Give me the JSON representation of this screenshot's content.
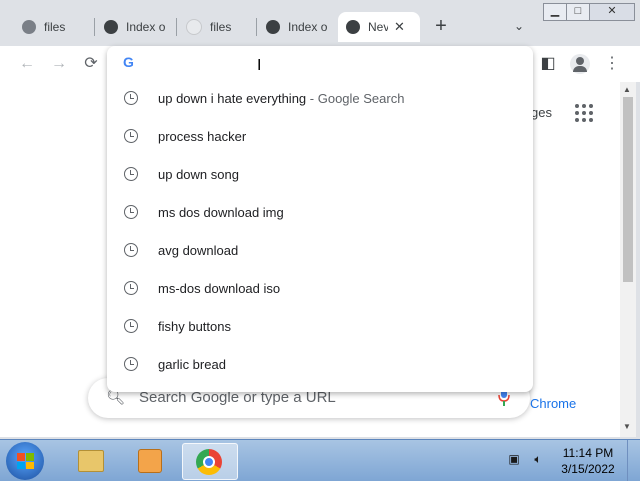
{
  "browser": {
    "tabs": [
      {
        "label": "files",
        "icon": "globe-icon",
        "active": false
      },
      {
        "label": "Index o",
        "icon": "chrome-logo-icon",
        "active": false
      },
      {
        "label": "files",
        "icon": "blank-page-icon",
        "active": false
      },
      {
        "label": "Index o",
        "icon": "chrome-logo-icon",
        "active": false
      },
      {
        "label": "Nev",
        "icon": "chrome-logo-icon",
        "active": true
      }
    ],
    "newtab_symbol": "+",
    "tab_close_symbol": "✕",
    "tabmenu_symbol": "⌄",
    "window_controls": {
      "minimize": "▁",
      "maximize": "□",
      "close": "✕"
    }
  },
  "omnibox": {
    "provider_icon_text": "G",
    "value": "",
    "suggestions": [
      {
        "text": "up down i hate everything",
        "suffix": "- Google Search"
      },
      {
        "text": "process hacker",
        "suffix": ""
      },
      {
        "text": "up down song",
        "suffix": ""
      },
      {
        "text": "ms dos download img",
        "suffix": ""
      },
      {
        "text": "avg download",
        "suffix": ""
      },
      {
        "text": "ms-dos download iso",
        "suffix": ""
      },
      {
        "text": "fishy buttons",
        "suffix": ""
      },
      {
        "text": "garlic bread",
        "suffix": ""
      }
    ]
  },
  "newtab_page": {
    "apps_partial": "ges",
    "search_placeholder": "Search Google or type a URL",
    "customize_partial": "Chrome"
  },
  "taskbar": {
    "time": "11:14 PM",
    "date": "3/15/2022"
  },
  "colors": {
    "accent": "#1a73e8",
    "tabstrip_bg": "#dee1e6",
    "taskbar_bg": "#8fb2db"
  }
}
